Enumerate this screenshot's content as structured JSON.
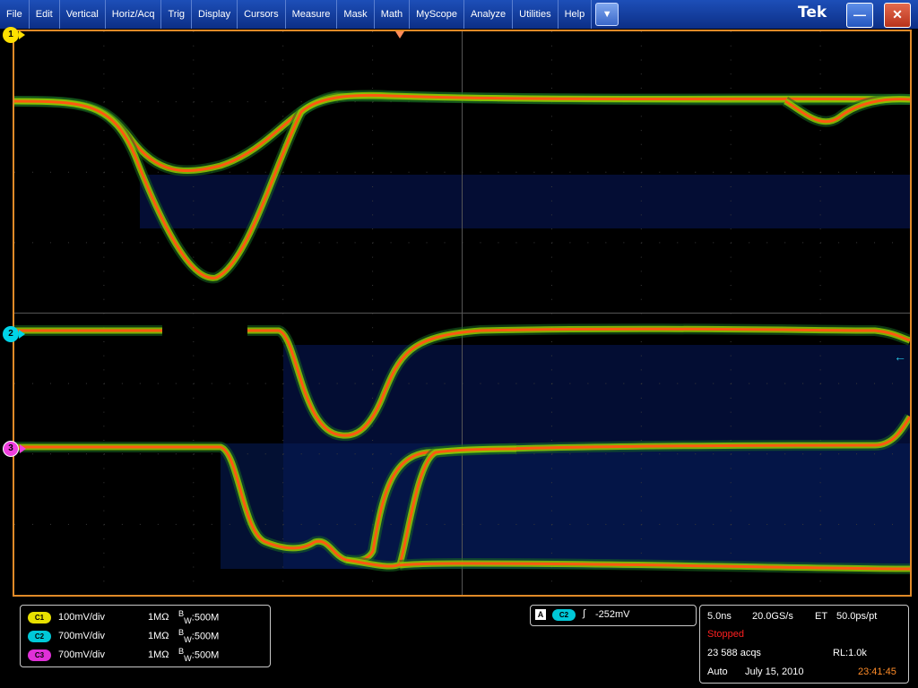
{
  "menu": {
    "items": [
      "File",
      "Edit",
      "Vertical",
      "Horiz/Acq",
      "Trig",
      "Display",
      "Cursors",
      "Measure",
      "Mask",
      "Math",
      "MyScope",
      "Analyze",
      "Utilities",
      "Help"
    ],
    "dropdown_icon": "▼",
    "brand": "Tek",
    "minimize_icon": "—",
    "close_icon": "✕"
  },
  "markers": {
    "ch1": "1",
    "ch2": "2",
    "ch3": "3"
  },
  "channels": [
    {
      "badge": "C1",
      "scale": "100mV/div",
      "impedance": "1MΩ",
      "bw_sup": "B",
      "bw_sub": "W",
      "bw": ":500M",
      "color": "#e8e000"
    },
    {
      "badge": "C2",
      "scale": "700mV/div",
      "impedance": "1MΩ",
      "bw_sup": "B",
      "bw_sub": "W",
      "bw": ":500M",
      "color": "#00c8d8"
    },
    {
      "badge": "C3",
      "scale": "700mV/div",
      "impedance": "1MΩ",
      "bw_sup": "B",
      "bw_sub": "W",
      "bw": ":500M",
      "color": "#e030d8"
    }
  ],
  "trigger": {
    "mode_badge": "A",
    "source": "C2",
    "slope_icon": "∫",
    "level": "-252mV"
  },
  "timebase": {
    "scale": "5.0ns",
    "sample_rate": "20.0GS/s",
    "mode": "ET",
    "resolution": "50.0ps/pt",
    "status": "Stopped",
    "acquisitions": "23 588 acqs",
    "record_length": "RL:1.0k",
    "trigger_mode": "Auto",
    "date": "July 15, 2010",
    "time": "23:41:45"
  },
  "colors": {
    "accent": "#e08a28",
    "menubar": "#0c2f86",
    "ch1": "#ffe000",
    "ch2": "#00d4e8",
    "ch3": "#f040e0"
  }
}
